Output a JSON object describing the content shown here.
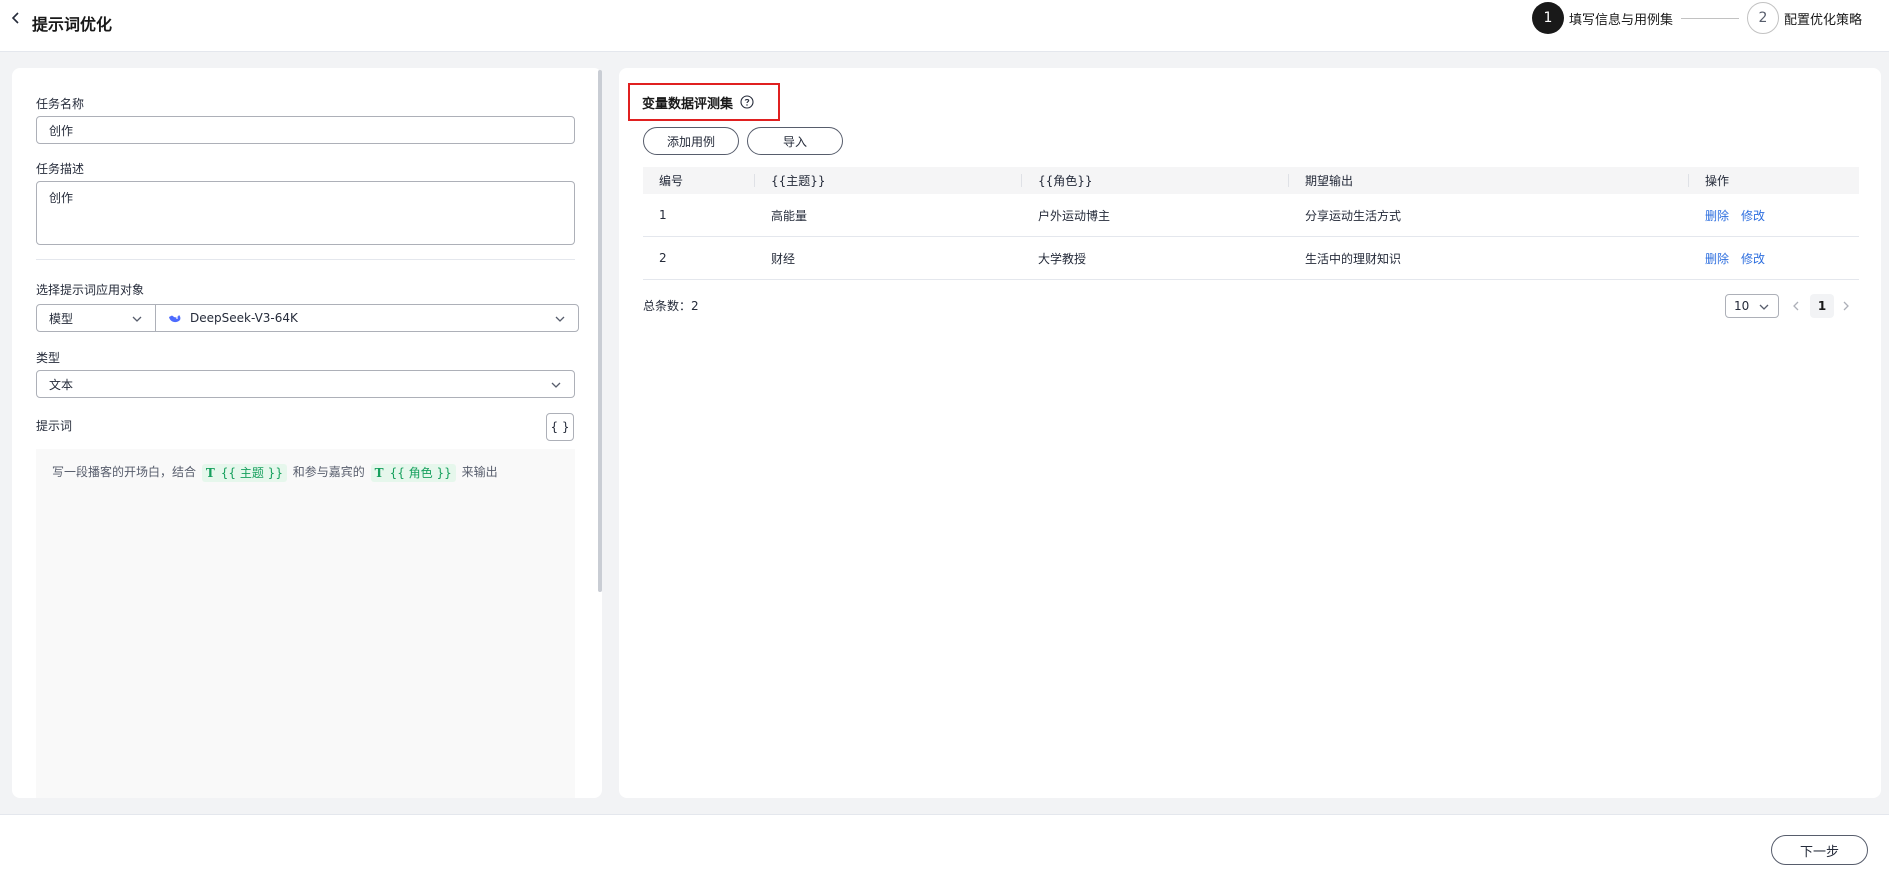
{
  "header": {
    "title": "提示词优化",
    "steps": [
      {
        "num": "1",
        "label": "填写信息与用例集",
        "active": true
      },
      {
        "num": "2",
        "label": "配置优化策略",
        "active": false
      }
    ]
  },
  "form": {
    "task_name_label": "任务名称",
    "task_name_value": "创作",
    "task_desc_label": "任务描述",
    "task_desc_value": "创作",
    "target_label": "选择提示词应用对象",
    "target_kind": "模型",
    "target_model": "DeepSeek-V3-64K",
    "type_label": "类型",
    "type_value": "文本",
    "prompt_label": "提示词",
    "braces_label": "{ }",
    "prompt": {
      "part1": "写一段播客的开场白，结合",
      "var1": "{{ 主题 }}",
      "part2": "和参与嘉宾的",
      "var2": "{{ 角色 }}",
      "part3": "来输出",
      "var_icon": "T"
    }
  },
  "dataset": {
    "title": "变量数据评测集",
    "add_button": "添加用例",
    "import_button": "导入",
    "columns": [
      "编号",
      "{{主题}}",
      "{{角色}}",
      "期望输出",
      "操作"
    ],
    "rows": [
      {
        "id": "1",
        "topic": "高能量",
        "role": "户外运动博主",
        "expected": "分享运动生活方式",
        "delete": "删除",
        "edit": "修改"
      },
      {
        "id": "2",
        "topic": "财经",
        "role": "大学教授",
        "expected": "生活中的理财知识",
        "delete": "删除",
        "edit": "修改"
      }
    ],
    "total_label": "总条数：2",
    "page_size": "10",
    "current_page": "1"
  },
  "footer": {
    "next_button": "下一步"
  },
  "colors": {
    "highlight_border": "#e02020",
    "link": "#2e6fdf",
    "variable": "#16a05d"
  }
}
